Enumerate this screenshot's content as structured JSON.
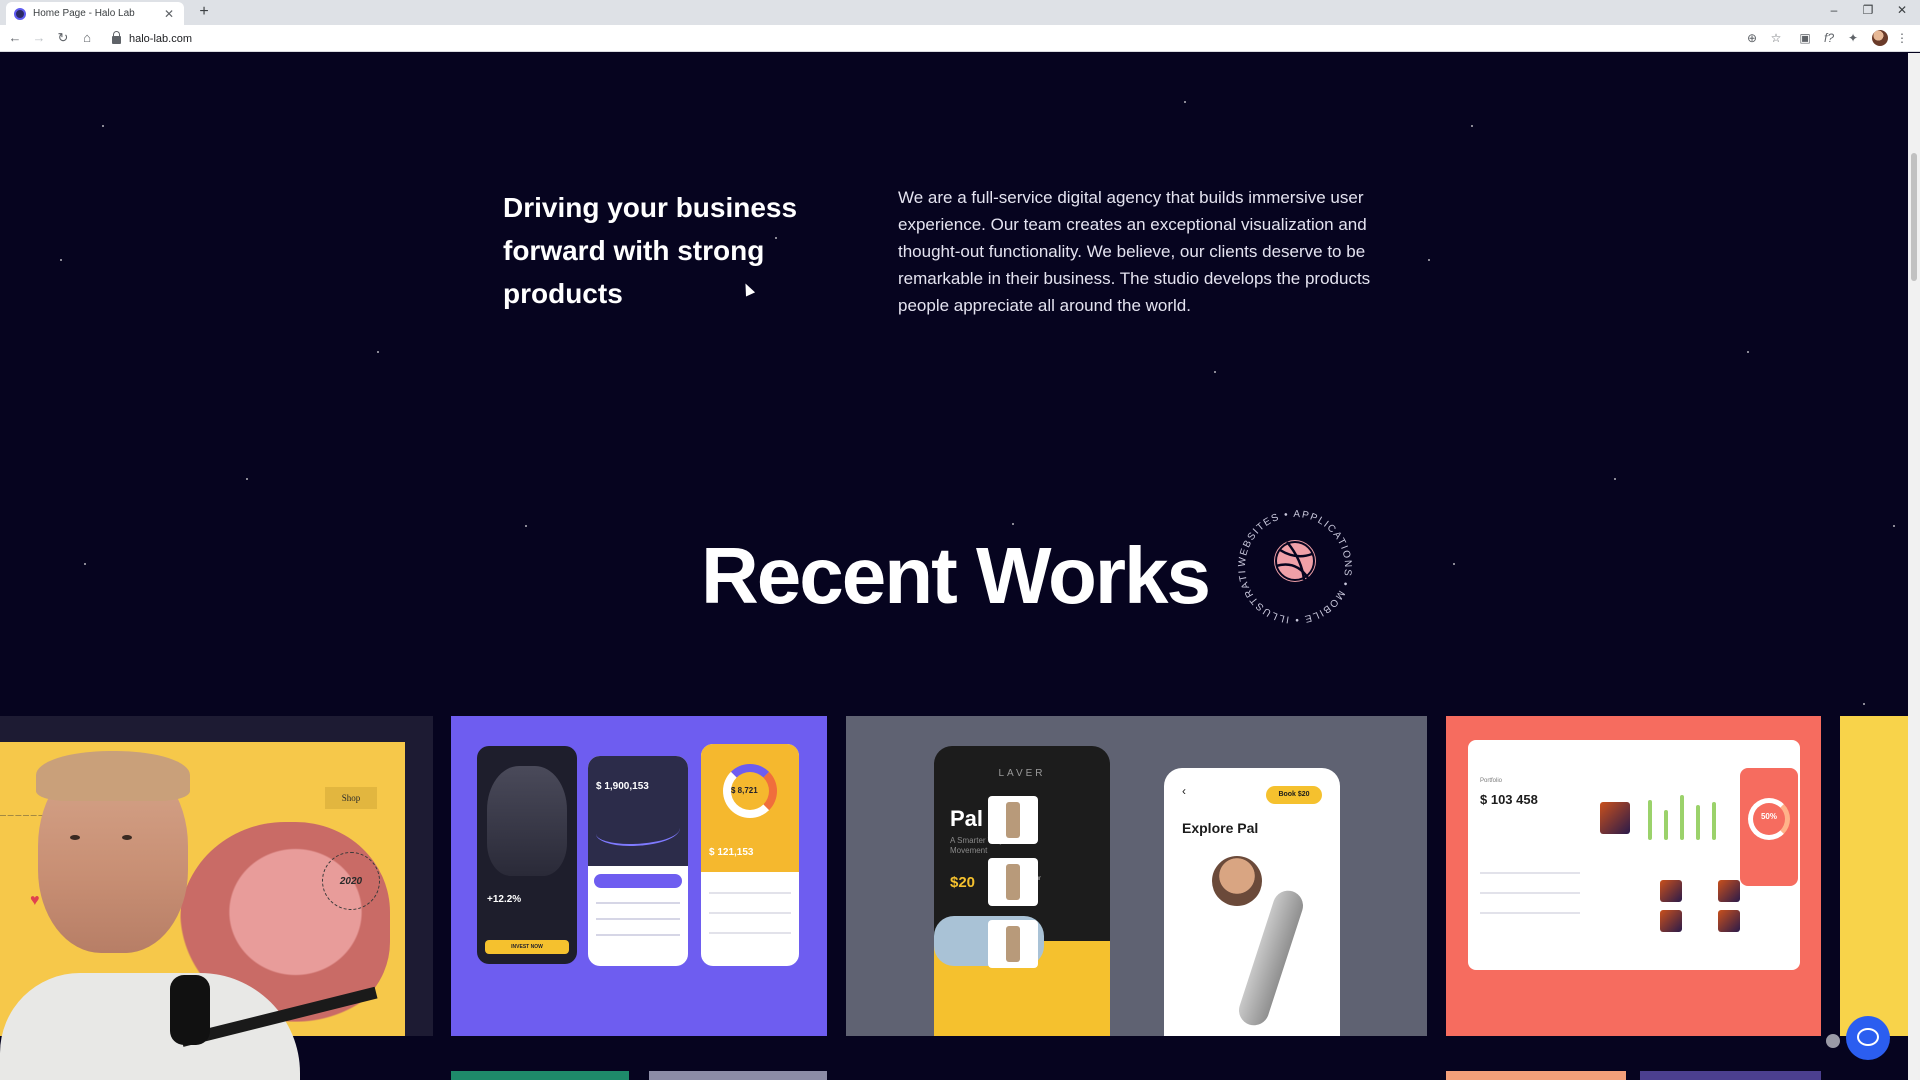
{
  "browser": {
    "tab_title": "Home Page - Halo Lab",
    "new_tab": "+",
    "url": "halo-lab.com",
    "minimize": "–",
    "restore": "❐",
    "close": "✕"
  },
  "about": {
    "heading": "Driving your business forward with strong products",
    "text": "We are a full-service digital agency that builds immersive user experience. Our team creates an exceptional visualization and thought-out functionality. We believe, our clients deserve to be remarkable in their business. The studio develops the products people appreciate all around the world."
  },
  "recent_works": {
    "title": "Recent Works",
    "badge_text": "WEBSITES • APPLICATIONS • MOBILE • ILLUSTRATIONS •"
  },
  "works": {
    "card1": {
      "shop": "Shop",
      "stamp": "2020"
    },
    "card2": {
      "pct": "+12.2%",
      "invest": "INVEST NOW",
      "balance": "$ 1,900,153",
      "ring_value": "$ 8,721",
      "total": "$ 121,153"
    },
    "card3": {
      "brand": "LAVER",
      "name": "Pal",
      "subtitle": "A Smarter Way for Movement",
      "price": "$20",
      "price_note": "price per hour",
      "book": "Book   $20",
      "explore": "Explore Pal"
    },
    "card4": {
      "portfolio": "Portfolio",
      "amount": "$ 103 458",
      "perf": "50%"
    }
  },
  "colors": {
    "page_bg": "#06041f",
    "accent_purple": "#6e5df0",
    "accent_coral": "#f66c5f",
    "accent_yellow": "#f5c12e"
  }
}
